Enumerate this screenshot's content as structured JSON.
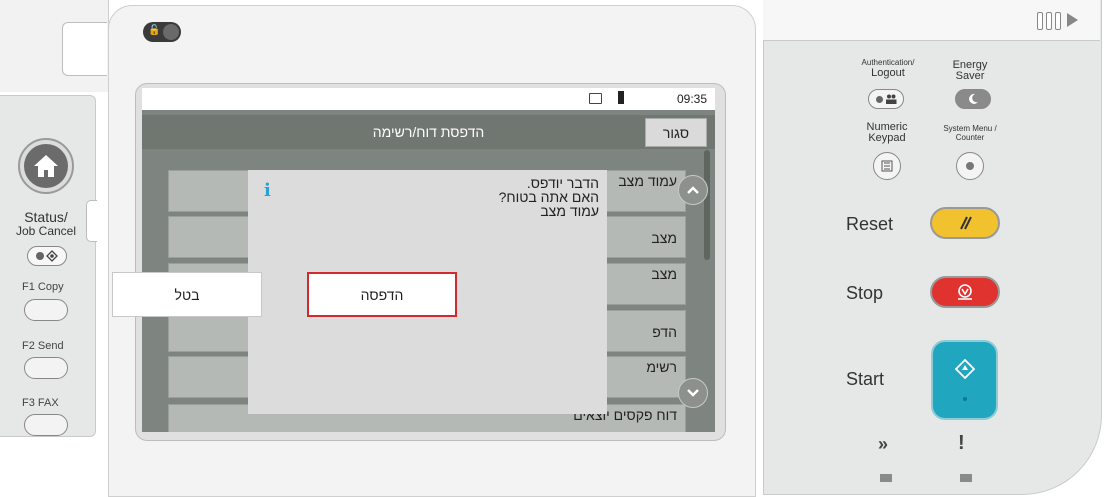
{
  "left_panel": {
    "status_label_line1": "Status/",
    "status_label_line2": "Job Cancel",
    "f1_label": "F1  Copy",
    "f2_label": "F2  Send",
    "f3_label": "F3  FAX"
  },
  "screen": {
    "time": "09:35",
    "title": "הדפסת דוח/רשימה",
    "close_label": "סגור",
    "list_items": [
      "עמוד מצב",
      "מצב",
      "מצב",
      "הדפ",
      "רשימ",
      "דוח פקסים יוצאים"
    ],
    "dialog": {
      "line1": "הדבר יודפס.",
      "line2": "האם אתה בטוח?",
      "line3": "עמוד מצב",
      "cancel_label": "בטל",
      "print_label": "הדפסה"
    }
  },
  "right_panel": {
    "auth_label_line1": "Authentication/",
    "auth_label_line2": "Logout",
    "energy_label_line1": "Energy",
    "energy_label_line2": "Saver",
    "numeric_label_line1": "Numeric",
    "numeric_label_line2": "Keypad",
    "sysmenu_label_line1": "System Menu /",
    "sysmenu_label_line2": "Counter",
    "reset_label": "Reset",
    "stop_label": "Stop",
    "start_label": "Start",
    "bottom_icon_left": "»",
    "bottom_icon_right": "!"
  },
  "colors": {
    "reset": "#f2c12e",
    "stop": "#e0332f",
    "start": "#21a6bf",
    "highlight": "#d2282e",
    "info": "#2aa0d6"
  }
}
